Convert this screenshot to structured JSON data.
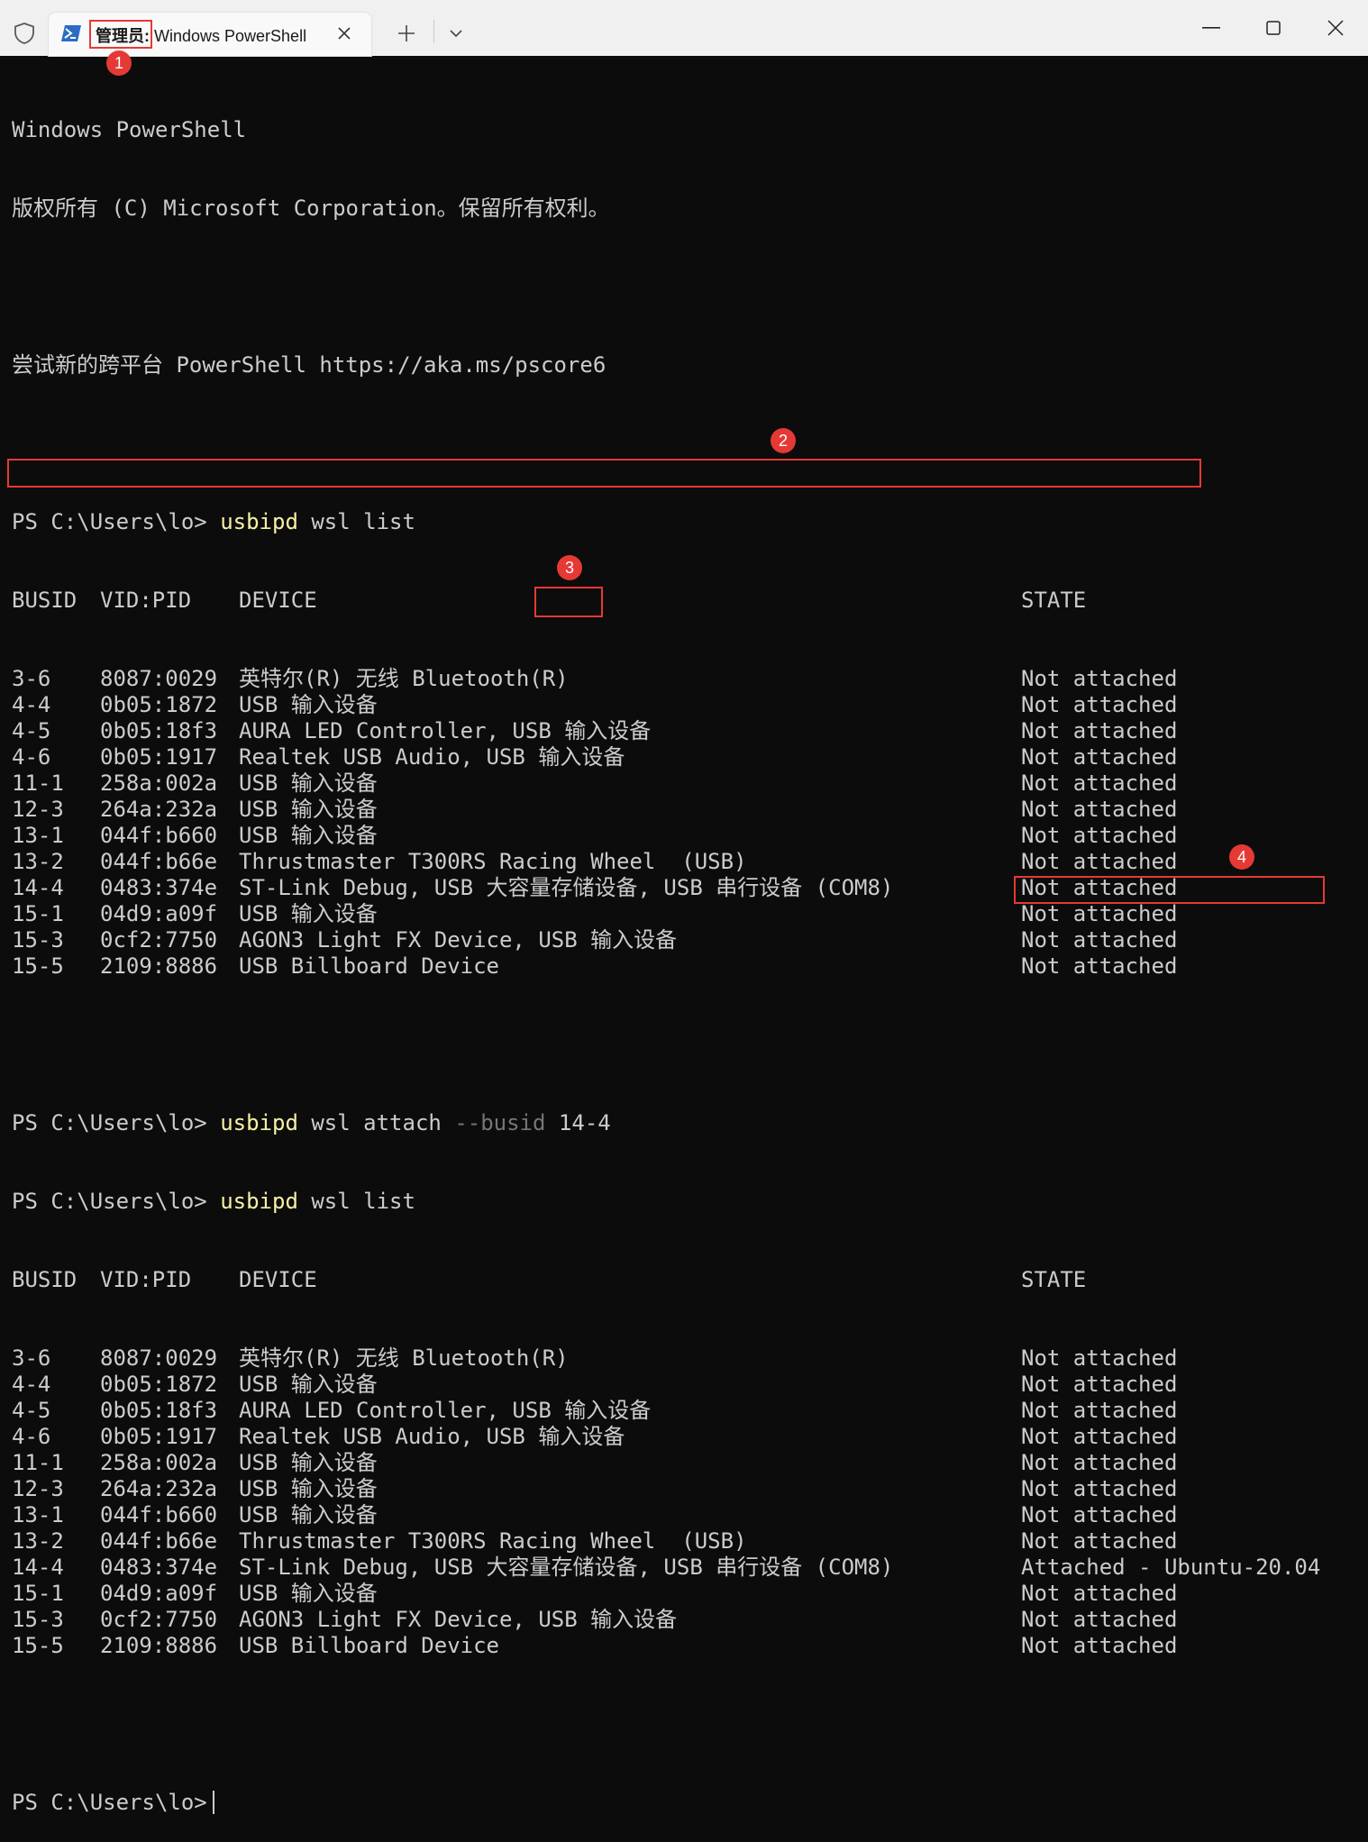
{
  "tab": {
    "title_prefix": "管理员:",
    "title_rest": " Windows PowerShell"
  },
  "terminal": {
    "banner1": "Windows PowerShell",
    "banner2": "版权所有 (C) Microsoft Corporation。保留所有权利。",
    "banner3": "尝试新的跨平台 PowerShell https://aka.ms/pscore6",
    "prompt": "PS C:\\Users\\lo>",
    "cmd_usbipd": "usbipd",
    "cmd_list_args": "wsl list",
    "cmd_attach_args": "wsl attach",
    "cmd_busid_flag": "--busid",
    "cmd_busid_value": "14-4",
    "headers": {
      "busid": "BUSID",
      "vidpid": "VID:PID",
      "device": "DEVICE",
      "state": "STATE"
    },
    "list1": [
      {
        "busid": "3-6",
        "vidpid": "8087:0029",
        "device": "英特尔(R) 无线 Bluetooth(R)",
        "state": "Not attached"
      },
      {
        "busid": "4-4",
        "vidpid": "0b05:1872",
        "device": "USB 输入设备",
        "state": "Not attached"
      },
      {
        "busid": "4-5",
        "vidpid": "0b05:18f3",
        "device": "AURA LED Controller, USB 输入设备",
        "state": "Not attached"
      },
      {
        "busid": "4-6",
        "vidpid": "0b05:1917",
        "device": "Realtek USB Audio, USB 输入设备",
        "state": "Not attached"
      },
      {
        "busid": "11-1",
        "vidpid": "258a:002a",
        "device": "USB 输入设备",
        "state": "Not attached"
      },
      {
        "busid": "12-3",
        "vidpid": "264a:232a",
        "device": "USB 输入设备",
        "state": "Not attached"
      },
      {
        "busid": "13-1",
        "vidpid": "044f:b660",
        "device": "USB 输入设备",
        "state": "Not attached"
      },
      {
        "busid": "13-2",
        "vidpid": "044f:b66e",
        "device": "Thrustmaster T300RS Racing Wheel  (USB)",
        "state": "Not attached"
      },
      {
        "busid": "14-4",
        "vidpid": "0483:374e",
        "device": "ST-Link Debug, USB 大容量存储设备, USB 串行设备 (COM8)",
        "state": "Not attached"
      },
      {
        "busid": "15-1",
        "vidpid": "04d9:a09f",
        "device": "USB 输入设备",
        "state": "Not attached"
      },
      {
        "busid": "15-3",
        "vidpid": "0cf2:7750",
        "device": "AGON3 Light FX Device, USB 输入设备",
        "state": "Not attached"
      },
      {
        "busid": "15-5",
        "vidpid": "2109:8886",
        "device": "USB Billboard Device",
        "state": "Not attached"
      }
    ],
    "list2": [
      {
        "busid": "3-6",
        "vidpid": "8087:0029",
        "device": "英特尔(R) 无线 Bluetooth(R)",
        "state": "Not attached"
      },
      {
        "busid": "4-4",
        "vidpid": "0b05:1872",
        "device": "USB 输入设备",
        "state": "Not attached"
      },
      {
        "busid": "4-5",
        "vidpid": "0b05:18f3",
        "device": "AURA LED Controller, USB 输入设备",
        "state": "Not attached"
      },
      {
        "busid": "4-6",
        "vidpid": "0b05:1917",
        "device": "Realtek USB Audio, USB 输入设备",
        "state": "Not attached"
      },
      {
        "busid": "11-1",
        "vidpid": "258a:002a",
        "device": "USB 输入设备",
        "state": "Not attached"
      },
      {
        "busid": "12-3",
        "vidpid": "264a:232a",
        "device": "USB 输入设备",
        "state": "Not attached"
      },
      {
        "busid": "13-1",
        "vidpid": "044f:b660",
        "device": "USB 输入设备",
        "state": "Not attached"
      },
      {
        "busid": "13-2",
        "vidpid": "044f:b66e",
        "device": "Thrustmaster T300RS Racing Wheel  (USB)",
        "state": "Not attached"
      },
      {
        "busid": "14-4",
        "vidpid": "0483:374e",
        "device": "ST-Link Debug, USB 大容量存储设备, USB 串行设备 (COM8)",
        "state": "Attached - Ubuntu-20.04"
      },
      {
        "busid": "15-1",
        "vidpid": "04d9:a09f",
        "device": "USB 输入设备",
        "state": "Not attached"
      },
      {
        "busid": "15-3",
        "vidpid": "0cf2:7750",
        "device": "AGON3 Light FX Device, USB 输入设备",
        "state": "Not attached"
      },
      {
        "busid": "15-5",
        "vidpid": "2109:8886",
        "device": "USB Billboard Device",
        "state": "Not attached"
      }
    ]
  },
  "annotations": {
    "badge1": "1",
    "badge2": "2",
    "badge3": "3",
    "badge4": "4"
  },
  "colors": {
    "background": "#0c0c0c",
    "text": "#cccccc",
    "command": "#f9f1a5",
    "parameter": "#767676",
    "highlight": "#e53935"
  },
  "icons": [
    "shield-icon",
    "powershell-icon",
    "close-icon",
    "plus-icon",
    "chevron-down-icon",
    "minimize-icon",
    "maximize-icon",
    "window-close-icon"
  ]
}
